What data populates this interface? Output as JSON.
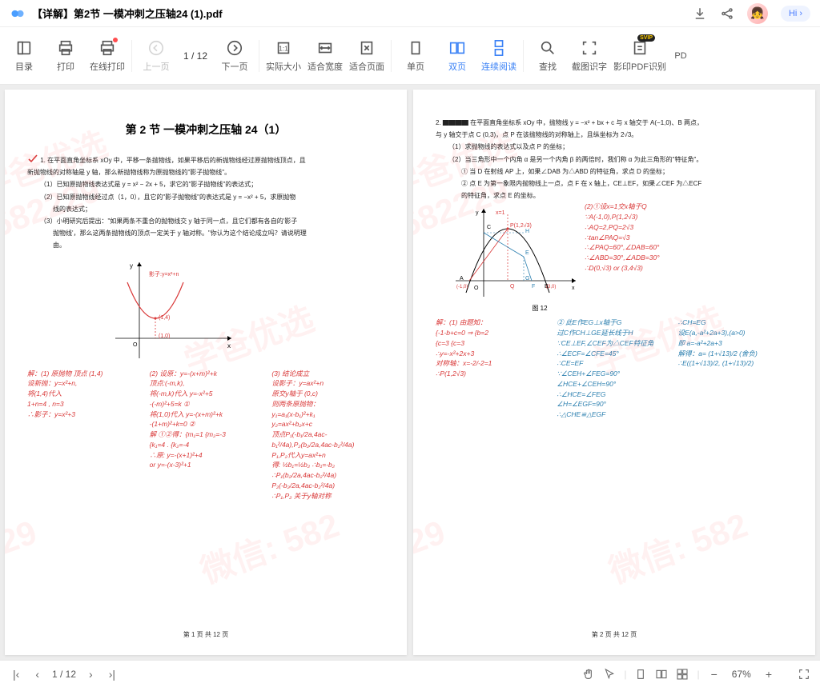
{
  "titlebar": {
    "filename": "【详解】第2节 一模冲刺之压轴24 (1).pdf",
    "hi_label": "Hi"
  },
  "toolbar": {
    "items": [
      {
        "label": "目录"
      },
      {
        "label": "打印"
      },
      {
        "label": "在线打印"
      },
      {
        "label": "上一页"
      }
    ],
    "page_indicator": "1 / 12",
    "items2": [
      {
        "label": "下一页"
      },
      {
        "label": "实际大小"
      },
      {
        "label": "适合宽度"
      },
      {
        "label": "适合页面"
      },
      {
        "label": "单页"
      },
      {
        "label": "双页"
      },
      {
        "label": "连续阅读"
      },
      {
        "label": "查找"
      },
      {
        "label": "截图识字"
      },
      {
        "label": "影印PDF识别"
      },
      {
        "label": "PD"
      }
    ]
  },
  "page1": {
    "title": "第 2 节  一模冲刺之压轴 24（1）",
    "line1": "1. 在平面直角坐标系 xOy 中，平移一条抛物线，如果平移后的新抛物线经过原抛物线顶点，且",
    "line2": "新抛物线的对称轴是 y 轴，那么新抛物线称为原抛物线的\"影子抛物线\"。",
    "sub1": "（1）已知原抛物线表达式是 y = x² − 2x + 5，求它的\"影子抛物线\"的表达式；",
    "sub2": "（2）已知原抛物线经过点（1，0），且它的\"影子抛物线\"的表达式是 y = −x² + 5，求原抛物",
    "sub2b": "线的表达式；",
    "sub3": "（3）小明研究后提出：\"如果两条不重合的抛物线交 y 轴于同一点，且它们都有各自的'影子",
    "sub3b": "抛物线'，那么这两条抛物线的顶点一定关于 y 轴对称。\"你认为这个结论成立吗？请说明理",
    "sub3c": "由。",
    "hw": {
      "c1": [
        "解：(1) 原抛物 顶点 (1,4)",
        "设新抛：y=x²+n,",
        "将(1,4)代入",
        "1+n=4 , n=3",
        "∴影子：y=x²+3"
      ],
      "c2": [
        "(2) 设原：y=-(x+m)²+k",
        "顶点:(-m,k),",
        "将(-m,k)代入 y=-x²+5",
        "-(-m)²+5=k ①",
        "将(1,0)代入 y=-(x+m)²+k",
        "-(1+m)²+k=0 ②",
        "解 ①②得：{m₁=1  {m₂=-3",
        "             {k₁=4 . {k₂=-4",
        "∴原: y=-(x+1)²+4",
        " or  y=-(x-3)²+1"
      ],
      "c3": [
        "(3) 结论成立",
        "设影子：y=ax²+n",
        "原交y轴于 (0,c)",
        "则两条原抛物：",
        "y₁=a₁(x-b₁)²+k₁",
        "y₂=ax²+b₂x+c",
        "顶点P₁(-b₁/2a,4ac-b₁²/4a),P₂(b₂/2a,4ac-b₂²/4a)",
        "P₁,P₂代入y=ax²+n",
        "得: ½b₁=½b₂ ∴b₁=-b₂",
        "∴P₁(b₂/2a,4ac-b₂²/4a)",
        "P₂(-b₂/2a,4ac-b₂²/4a)",
        "∴P₁,P₂ 关于y轴对称"
      ]
    },
    "footer": "第 1 页 共 12 页"
  },
  "page2": {
    "line1": "2. ▇▇▇▇ 在平面直角坐标系 xOy 中，抛物线 y = −x² + bx + c 与 x 轴交于 A(−1,0)、B 两点，",
    "line2": "与 y 轴交于点 C (0,3)，点 P 在该抛物线的对称轴上，且纵坐标为 2√3。",
    "sub1": "（1）求抛物线的表达式以及点 P 的坐标；",
    "sub2": "（2）当三角形中一个内角 α 是另一个内角 β 的两倍时，我们称 α 为此三角形的\"特征角\"。",
    "sub2a": "① 当 D 在射线 AP 上，如果∠DAB 为△ABD 的特征角，求点 D 的坐标；",
    "sub2b": "② 点 E 为第一象限内抛物线上一点，点 F 在 x 轴上，CE⊥EF，如果∠CEF 为△ECF",
    "sub2c": "的特征角，求点 E 的坐标。",
    "graph_label": "图 12",
    "hw": {
      "left": [
        "解：(1) 由题知：",
        "{-1-b+c=0  ⇒ {b=2",
        "{c=3         {c=3",
        "∴y=-x²+2x+3",
        "对称轴：x=-2/-2=1",
        "∴P(1,2√3)"
      ],
      "mid": [
        "② 此E作EG⊥x轴于G",
        "过C作CH⊥GE延长线于H",
        "∵CE⊥EF,∠CEF为△CEF特征角",
        "∴∠ECF=∠CFE=45°",
        "∴CE=EF",
        "∵∠CEH+∠FEG=90°",
        "∠HCE+∠CEH=90°",
        "∴∠HCE=∠FEG",
        "∠H=∠EGF=90°",
        "∴△CHE≌△EGF"
      ],
      "right_top": [
        "(2)①设x=1交x轴于Q",
        "∵A(-1,0),P(1,2√3)",
        "∴AQ=2,PQ=2√3",
        "∴tan∠PAQ=√3",
        "∴∠PAQ=60°,∠DAB=60°",
        "∴∠ABD=30°,∠ADB=30°",
        "∴D(0,√3) or (3,4√3)"
      ],
      "right_bot": [
        "∴CH=EG",
        "设E(a,-a²+2a+3),(a>0)",
        "即 a=-a²+2a+3",
        "解得：a= (1+√13)/2 (舍负)",
        "∴E((1+√13)/2, (1+√13)/2)"
      ]
    },
    "footer": "第 2 页 共 12 页"
  },
  "statusbar": {
    "page": "1 / 12",
    "zoom": "67%"
  }
}
